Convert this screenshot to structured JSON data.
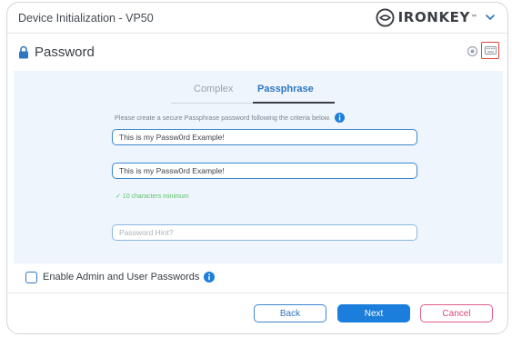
{
  "window": {
    "title": "Device Initialization - VP50",
    "brand": "IRONKEY",
    "brand_tm": "™"
  },
  "section": {
    "title": "Password"
  },
  "tabs": [
    {
      "label": "Complex",
      "active": false
    },
    {
      "label": "Passphrase",
      "active": true
    }
  ],
  "form": {
    "instructions": "Please create a secure Passphrase password following the criteria below.",
    "password_value": "This is my Passw0rd Example!",
    "confirm_value": "This is my Passw0rd Example!",
    "validation": "✓ 10 characters minimum",
    "hint_placeholder": "Password Hint?"
  },
  "admin_option": {
    "label": "Enable Admin and User Passwords",
    "checked": false
  },
  "buttons": {
    "back": "Back",
    "next": "Next",
    "cancel": "Cancel"
  },
  "colors": {
    "accent": "#1b7ddc",
    "panel": "#eef5fc",
    "cancel": "#d94b78",
    "highlight": "#e0423a",
    "valid": "#5cc46a"
  },
  "icons": {
    "lock": "lock-icon",
    "eye": "eye-icon",
    "keyboard": "keyboard-icon",
    "info": "info-icon",
    "chevron": "chevron-down-icon",
    "brand": "ironkey-logo-icon"
  }
}
